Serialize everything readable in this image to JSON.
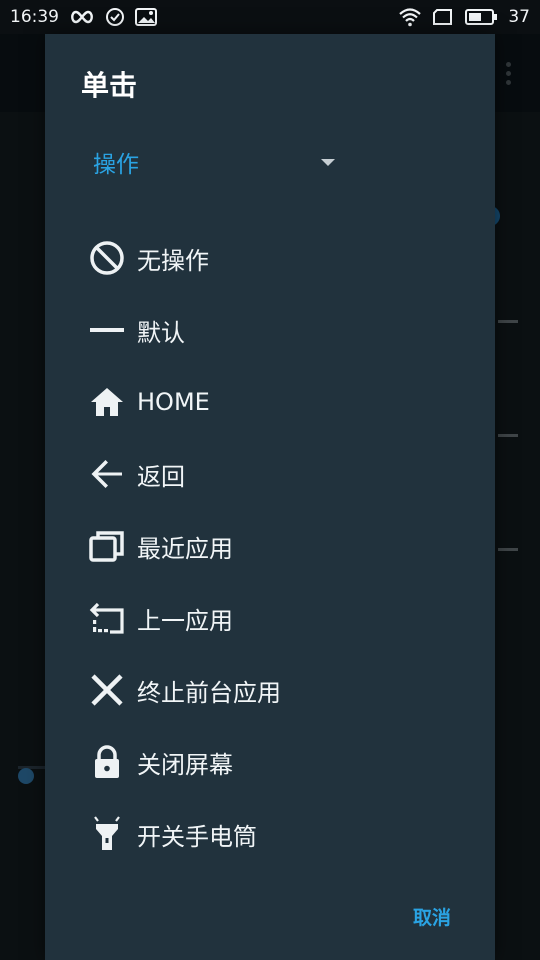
{
  "status_bar": {
    "time": "16:39",
    "battery": "37"
  },
  "dialog": {
    "title": "单击",
    "dropdown_value": "操作",
    "options": [
      {
        "label": "无操作",
        "icon": "no-entry-icon"
      },
      {
        "label": "默认",
        "icon": "minus-icon"
      },
      {
        "label": "HOME",
        "icon": "home-icon"
      },
      {
        "label": "返回",
        "icon": "back-arrow-icon"
      },
      {
        "label": "最近应用",
        "icon": "recent-apps-icon"
      },
      {
        "label": "上一应用",
        "icon": "previous-app-icon"
      },
      {
        "label": "终止前台应用",
        "icon": "close-icon"
      },
      {
        "label": "关闭屏幕",
        "icon": "lock-icon"
      },
      {
        "label": "开关手电筒",
        "icon": "flashlight-icon"
      }
    ],
    "cancel_label": "取消"
  },
  "colors": {
    "dialog_bg": "#21323d",
    "accent": "#2aa3e3"
  }
}
